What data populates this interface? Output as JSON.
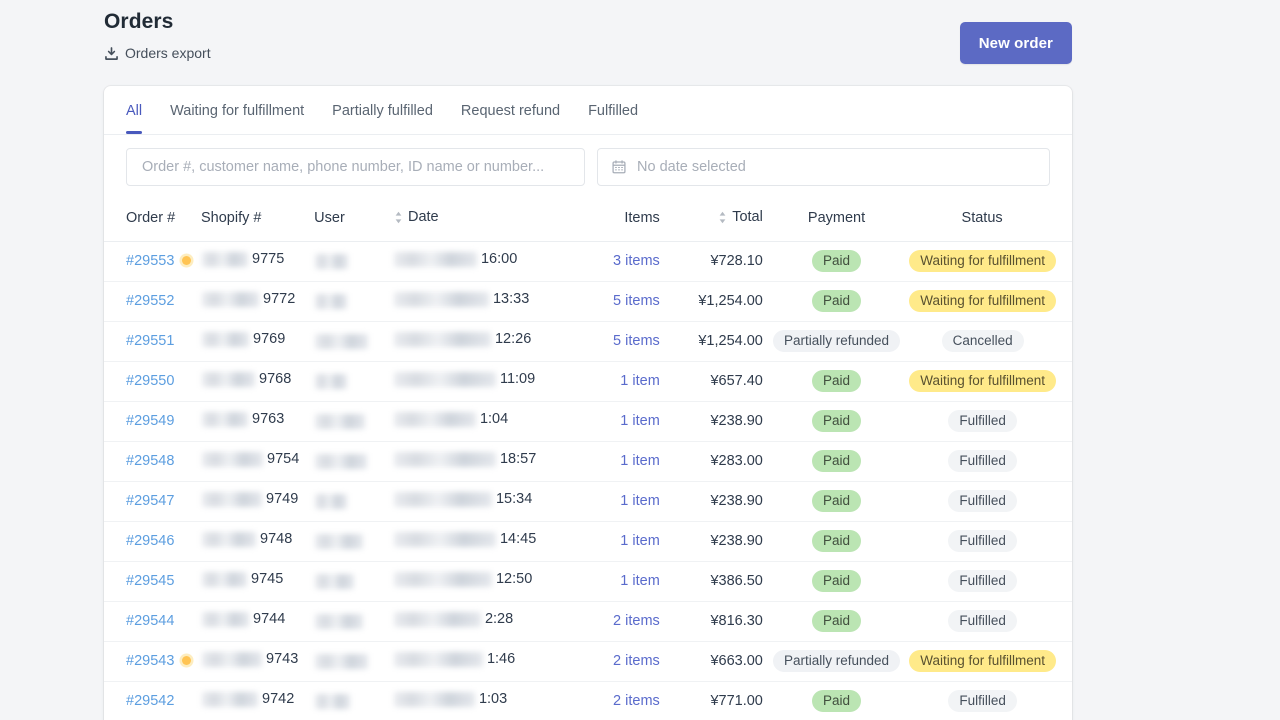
{
  "header": {
    "title": "Orders",
    "export_label": "Orders export",
    "export_icon": "download-icon",
    "new_order_label": "New order",
    "accent_color": "#5c6ac4"
  },
  "tabs": [
    {
      "label": "All",
      "active": true
    },
    {
      "label": "Waiting for fulfillment",
      "active": false
    },
    {
      "label": "Partially fulfilled",
      "active": false
    },
    {
      "label": "Request refund",
      "active": false
    },
    {
      "label": "Fulfilled",
      "active": false
    }
  ],
  "filters": {
    "search_placeholder": "Order #, customer name, phone number, ID name or number...",
    "search_value": "",
    "date_label": "No date selected",
    "date_icon": "calendar-icon"
  },
  "table": {
    "columns": [
      {
        "key": "order",
        "label": "Order #",
        "sortable": false
      },
      {
        "key": "shopify",
        "label": "Shopify #",
        "sortable": false
      },
      {
        "key": "user",
        "label": "User",
        "sortable": false
      },
      {
        "key": "date",
        "label": "Date",
        "sortable": true
      },
      {
        "key": "items",
        "label": "Items",
        "sortable": false
      },
      {
        "key": "total",
        "label": "Total",
        "sortable": true
      },
      {
        "key": "payment",
        "label": "Payment",
        "sortable": false
      },
      {
        "key": "status",
        "label": "Status",
        "sortable": false
      }
    ],
    "rows": [
      {
        "order": "#29553",
        "flag": true,
        "shopify_suffix": "9775",
        "time": "16:00",
        "items": "3 items",
        "total": "¥728.10",
        "payment": "Paid",
        "payment_type": "paid",
        "status": "Waiting for fulfillment",
        "status_type": "waiting"
      },
      {
        "order": "#29552",
        "flag": false,
        "shopify_suffix": "9772",
        "time": "13:33",
        "items": "5 items",
        "total": "¥1,254.00",
        "payment": "Paid",
        "payment_type": "paid",
        "status": "Waiting for fulfillment",
        "status_type": "waiting"
      },
      {
        "order": "#29551",
        "flag": false,
        "shopify_suffix": "9769",
        "time": "12:26",
        "items": "5 items",
        "total": "¥1,254.00",
        "payment": "Partially refunded",
        "payment_type": "partial",
        "status": "Cancelled",
        "status_type": "cancelled"
      },
      {
        "order": "#29550",
        "flag": false,
        "shopify_suffix": "9768",
        "time": "11:09",
        "items": "1 item",
        "total": "¥657.40",
        "payment": "Paid",
        "payment_type": "paid",
        "status": "Waiting for fulfillment",
        "status_type": "waiting"
      },
      {
        "order": "#29549",
        "flag": false,
        "shopify_suffix": "9763",
        "time": "1:04",
        "items": "1 item",
        "total": "¥238.90",
        "payment": "Paid",
        "payment_type": "paid",
        "status": "Fulfilled",
        "status_type": "fulfilled"
      },
      {
        "order": "#29548",
        "flag": false,
        "shopify_suffix": "9754",
        "time": "18:57",
        "items": "1 item",
        "total": "¥283.00",
        "payment": "Paid",
        "payment_type": "paid",
        "status": "Fulfilled",
        "status_type": "fulfilled"
      },
      {
        "order": "#29547",
        "flag": false,
        "shopify_suffix": "9749",
        "time": "15:34",
        "items": "1 item",
        "total": "¥238.90",
        "payment": "Paid",
        "payment_type": "paid",
        "status": "Fulfilled",
        "status_type": "fulfilled"
      },
      {
        "order": "#29546",
        "flag": false,
        "shopify_suffix": "9748",
        "time": "14:45",
        "items": "1 item",
        "total": "¥238.90",
        "payment": "Paid",
        "payment_type": "paid",
        "status": "Fulfilled",
        "status_type": "fulfilled"
      },
      {
        "order": "#29545",
        "flag": false,
        "shopify_suffix": "9745",
        "time": "12:50",
        "items": "1 item",
        "total": "¥386.50",
        "payment": "Paid",
        "payment_type": "paid",
        "status": "Fulfilled",
        "status_type": "fulfilled"
      },
      {
        "order": "#29544",
        "flag": false,
        "shopify_suffix": "9744",
        "time": "2:28",
        "items": "2 items",
        "total": "¥816.30",
        "payment": "Paid",
        "payment_type": "paid",
        "status": "Fulfilled",
        "status_type": "fulfilled"
      },
      {
        "order": "#29543",
        "flag": true,
        "shopify_suffix": "9743",
        "time": "1:46",
        "items": "2 items",
        "total": "¥663.00",
        "payment": "Partially refunded",
        "payment_type": "partial",
        "status": "Waiting for fulfillment",
        "status_type": "waiting"
      },
      {
        "order": "#29542",
        "flag": false,
        "shopify_suffix": "9742",
        "time": "1:03",
        "items": "2 items",
        "total": "¥771.00",
        "payment": "Paid",
        "payment_type": "paid",
        "status": "Fulfilled",
        "status_type": "fulfilled"
      }
    ]
  },
  "colors": {
    "page_background": "#f4f5f7",
    "link": "#5c9ee0",
    "items_link": "#5a6bcc",
    "badge_paid": "#bbe5b3",
    "badge_waiting": "#ffea8a",
    "badge_neutral": "#f2f4f6",
    "flag_dot": "#ffc453"
  }
}
